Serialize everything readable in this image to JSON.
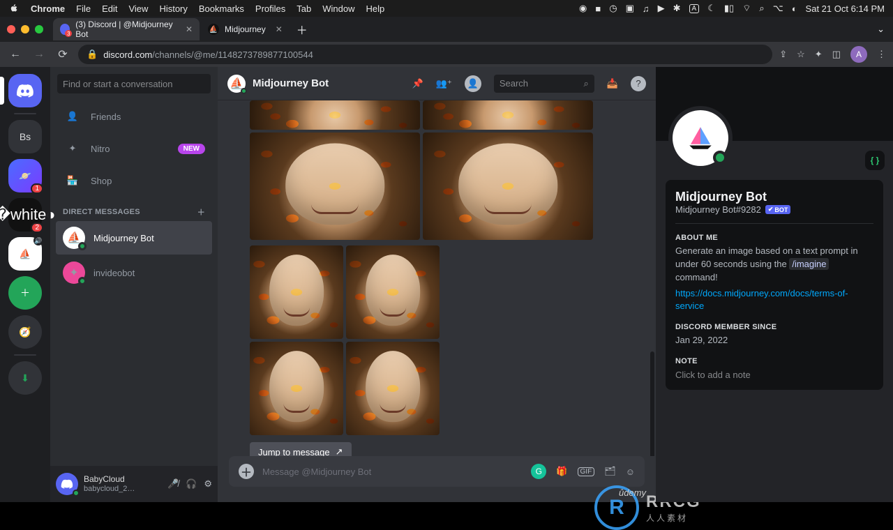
{
  "mac": {
    "apple": "",
    "app": "Chrome",
    "menus": [
      "File",
      "Edit",
      "View",
      "History",
      "Bookmarks",
      "Profiles",
      "Tab",
      "Window",
      "Help"
    ],
    "clock": "Sat 21 Oct  6:14 PM"
  },
  "tabs": {
    "t1": "(3) Discord | @Midjourney Bot",
    "t2": "Midjourney"
  },
  "url": {
    "host": "discord.com",
    "path": "/channels/@me/1148273789877100544"
  },
  "avatar_letter": "A",
  "dm_search": "Find or start a conversation",
  "nav": {
    "friends": "Friends",
    "nitro": "Nitro",
    "nitro_badge": "NEW",
    "shop": "Shop"
  },
  "dm_header": "DIRECT MESSAGES",
  "dms": {
    "a": "Midjourney Bot",
    "b": "invideobot"
  },
  "server_initials": "Bs",
  "user": {
    "name": "BabyCloud",
    "sub": "babycloud_2…"
  },
  "channel": {
    "title": "Midjourney Bot",
    "search": "Search"
  },
  "jump": "Jump to message",
  "composer": "Message @Midjourney Bot",
  "profile": {
    "name": "Midjourney Bot",
    "tag": "Midjourney Bot#9282",
    "bot": "BOT",
    "about_h": "ABOUT ME",
    "about_1": "Generate an image based on a text prompt in under 60 seconds using the ",
    "about_cmd": "/imagine",
    "about_2": " command!",
    "link": "https://docs.midjourney.com/docs/terms-of-service",
    "since_h": "DISCORD MEMBER SINCE",
    "since": "Jan 29, 2022",
    "note_h": "NOTE",
    "note_ph": "Click to add a note"
  },
  "wm": {
    "big": "RRCG",
    "sub": "人人素材"
  },
  "udemy": "ûdemy"
}
